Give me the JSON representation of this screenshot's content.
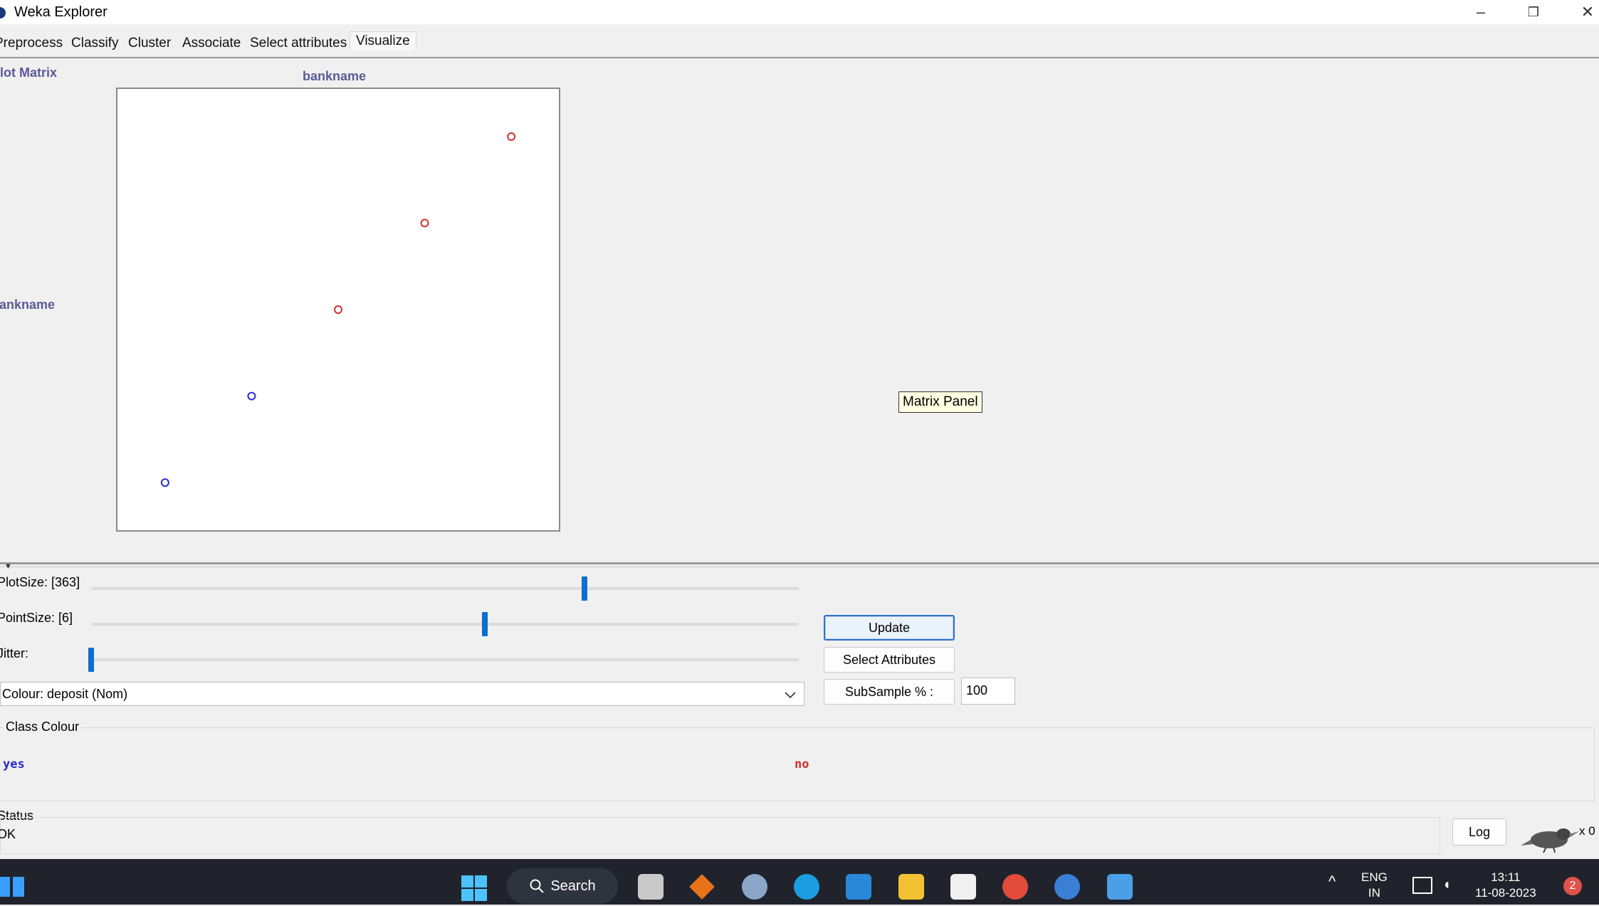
{
  "window": {
    "title": "Weka Explorer",
    "minimize": "–",
    "maximize": "❐",
    "close": "✕"
  },
  "tabs": [
    {
      "label": "Preprocess"
    },
    {
      "label": "Classify"
    },
    {
      "label": "Cluster"
    },
    {
      "label": "Associate"
    },
    {
      "label": "Select attributes"
    },
    {
      "label": "Visualize",
      "active": true
    }
  ],
  "plot_matrix": {
    "title": "Plot Matrix",
    "x_attribute": "bankname",
    "y_attribute": "bankname",
    "tooltip": "Matrix Panel"
  },
  "chart_data": {
    "type": "scatter",
    "xlabel": "bankname",
    "ylabel": "bankname",
    "points": [
      {
        "x": 1,
        "y": 1,
        "class": "yes"
      },
      {
        "x": 2,
        "y": 2,
        "class": "yes"
      },
      {
        "x": 3,
        "y": 3,
        "class": "no"
      },
      {
        "x": 4,
        "y": 4,
        "class": "no"
      },
      {
        "x": 5,
        "y": 5,
        "class": "no"
      }
    ],
    "xlim": [
      0.45,
      5.55
    ],
    "ylim": [
      0.45,
      5.55
    ],
    "class_colors": {
      "yes": "#2a2ad0",
      "no": "#d03030"
    }
  },
  "controls": {
    "plot_size_label": "PlotSize: [363]",
    "plot_size_value": 363,
    "point_size_label": "PointSize: [6]",
    "point_size_value": 6,
    "jitter_label": "Jitter:",
    "jitter_value": 0,
    "update_button": "Update",
    "select_attributes_button": "Select Attributes",
    "subsample_button": "SubSample % :",
    "subsample_value": "100",
    "colour_select": "Colour: deposit (Nom)"
  },
  "class_colour": {
    "legend_title": "Class Colour",
    "classes": [
      {
        "label": "yes",
        "color": "#2a2ad0"
      },
      {
        "label": "no",
        "color": "#d03030"
      }
    ]
  },
  "status": {
    "title": "Status",
    "text": "OK",
    "log_button": "Log",
    "task_count": "x 0"
  },
  "taskbar": {
    "search_label": "Search",
    "lang_line1": "ENG",
    "lang_line2": "IN",
    "time": "13:11",
    "date": "11-08-2023",
    "notification_count": "2"
  }
}
